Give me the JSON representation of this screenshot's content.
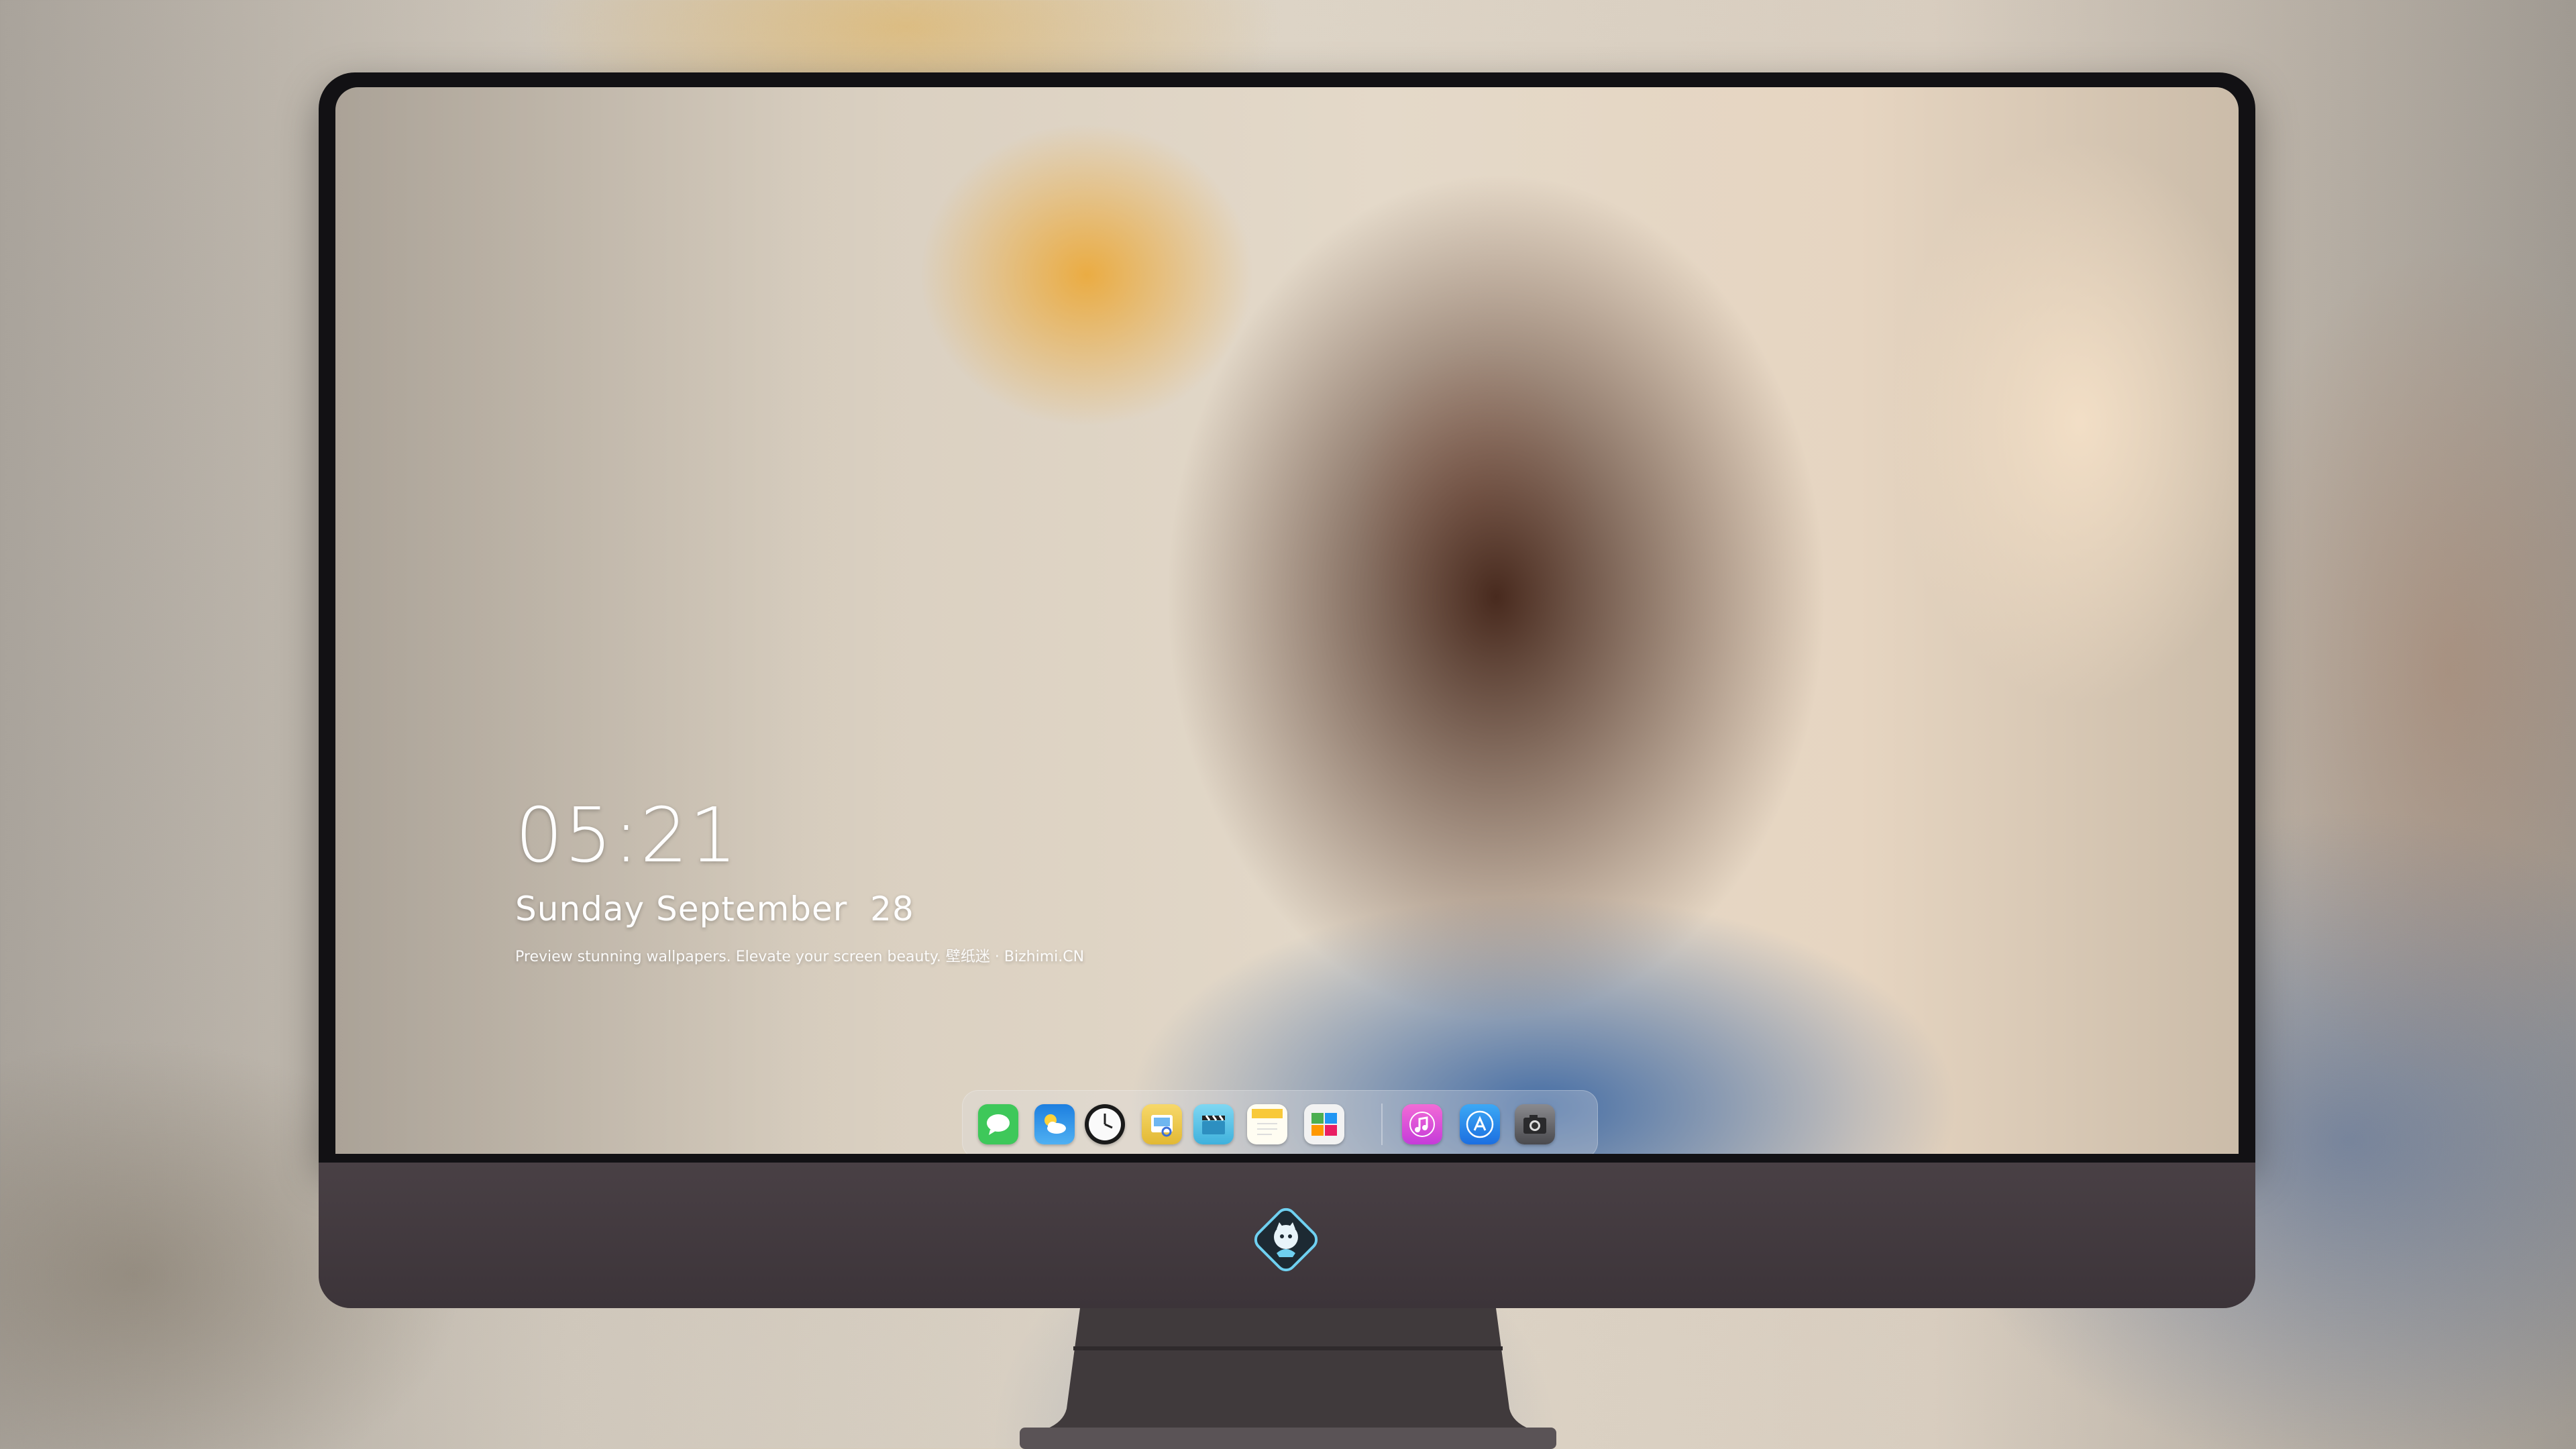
{
  "lock_screen": {
    "time": "05:21",
    "date": "Sunday September  28",
    "caption": "Preview stunning wallpapers. Elevate your screen beauty. 壁纸迷 · Bizhimi.CN"
  },
  "dock": {
    "apps": [
      {
        "name": "messages-icon",
        "color": "#3ec85a"
      },
      {
        "name": "weather-icon",
        "color": "#2a8fe6"
      },
      {
        "name": "clock-icon",
        "color": "#f2f2f2"
      },
      {
        "name": "preview-icon",
        "color": "#f5c842"
      },
      {
        "name": "video-icon",
        "color": "#5ec3e8"
      },
      {
        "name": "notes-icon",
        "color": "#f8d34a"
      },
      {
        "name": "photo-gallery-icon",
        "color": "#8bc34a"
      },
      {
        "name": "music-icon",
        "color": "#e04ccf"
      },
      {
        "name": "app-store-icon",
        "color": "#2b8df2"
      },
      {
        "name": "camera-icon",
        "color": "#6f6f72"
      }
    ]
  },
  "colors": {
    "bezel": "#121114",
    "chin": "#433a3f",
    "stand": "#403a3c"
  }
}
